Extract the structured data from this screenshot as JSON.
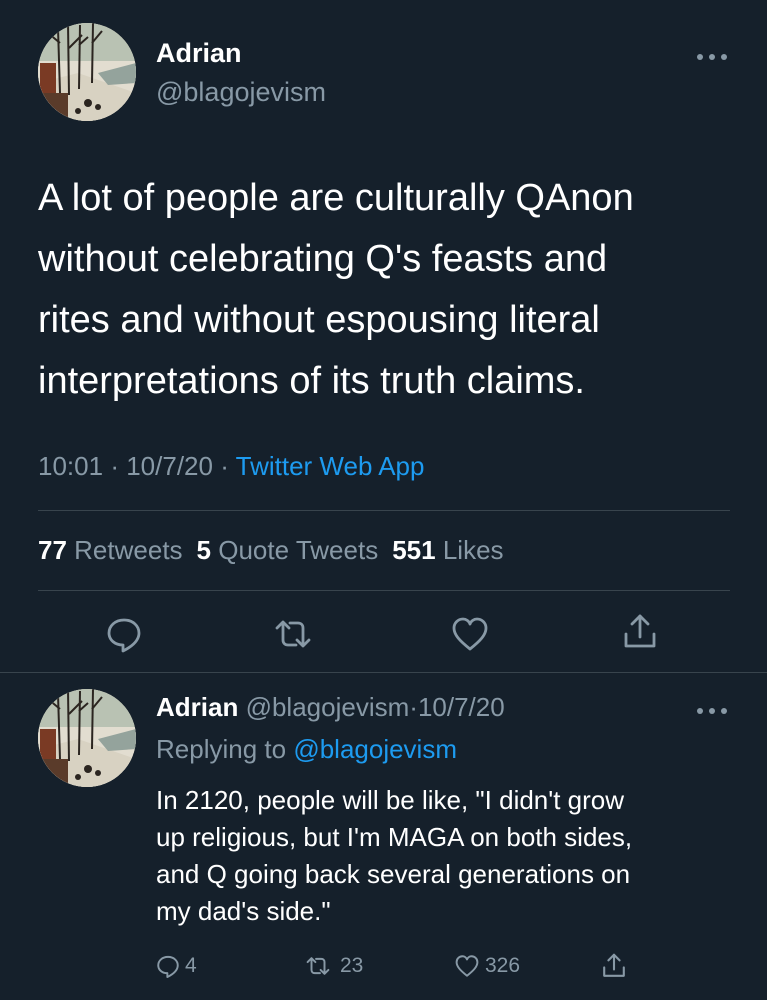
{
  "main_tweet": {
    "author_name": "Adrian",
    "author_handle": "@blagojevism",
    "text": "A lot of people are culturally QAnon\nwithout celebrating Q's feasts and\nrites and without espousing literal\ninterpretations of its truth claims.",
    "time": "10:01",
    "date": "10/7/20",
    "separator": "·",
    "source": "Twitter Web App",
    "stats": {
      "retweets_count": "77",
      "retweets_label": "Retweets",
      "quotes_count": "5",
      "quotes_label": "Quote Tweets",
      "likes_count": "551",
      "likes_label": "Likes"
    }
  },
  "reply_tweet": {
    "author_name": "Adrian",
    "author_handle": "@blagojevism",
    "separator": "·",
    "date": "10/7/20",
    "replying_label": "Replying to",
    "replying_handle": "@blagojevism",
    "text": "In 2120, people will be like, \"I didn't grow\nup religious, but I'm MAGA on both sides,\nand Q going back several generations on\nmy dad's side.\"",
    "reply_count": "4",
    "retweet_count": "23",
    "like_count": "326"
  },
  "icons": {
    "reply": "speech-bubble-icon",
    "retweet": "retweet-arrows-icon",
    "like": "heart-icon",
    "share": "share-upload-icon",
    "more": "more-dots-icon"
  },
  "colors": {
    "background": "#15202b",
    "muted_text": "#8899a6",
    "link_blue": "#1d9bf0",
    "divider": "#38444d"
  }
}
